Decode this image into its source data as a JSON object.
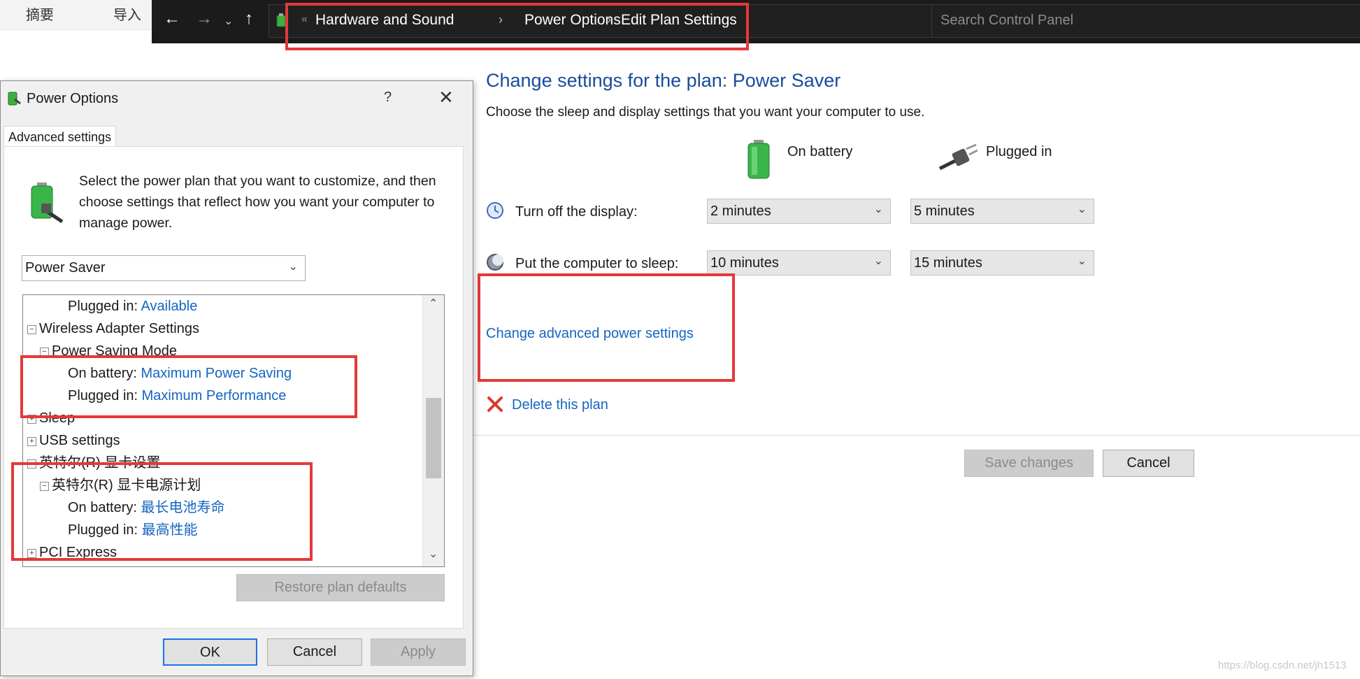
{
  "left_strip": {
    "tab1": "摘要",
    "tab2": "导入"
  },
  "address_bar": {
    "crumbs": [
      "Hardware and Sound",
      "Power Options",
      "Edit Plan Settings"
    ],
    "overflow": "«",
    "search_placeholder": "Search Control Panel"
  },
  "main": {
    "title": "Change settings for the plan: Power Saver",
    "description": "Choose the sleep and display settings that you want your computer to use.",
    "col_battery": "On battery",
    "col_plugged": "Plugged in",
    "rows": [
      {
        "label": "Turn off the display:",
        "battery": "2 minutes",
        "plugged": "5 minutes"
      },
      {
        "label": "Put the computer to sleep:",
        "battery": "10 minutes",
        "plugged": "15 minutes"
      }
    ],
    "advanced_link": "Change advanced power settings",
    "delete_link": "Delete this plan",
    "save_button": "Save changes",
    "cancel_button": "Cancel"
  },
  "dialog": {
    "title": "Power Options",
    "help": "?",
    "tab": "Advanced settings",
    "intro": "Select the power plan that you want to customize, and then choose settings that reflect how you want your computer to manage power.",
    "plan": "Power Saver",
    "tree": {
      "r1_label": "Plugged in:",
      "r1_value": "Available",
      "r2": "Wireless Adapter Settings",
      "r3": "Power Saving Mode",
      "r4_label": "On battery:",
      "r4_value": "Maximum Power Saving",
      "r5_label": "Plugged in:",
      "r5_value": "Maximum Performance",
      "r6": "Sleep",
      "r7": "USB settings",
      "r8": "英特尔(R) 显卡设置",
      "r9": "英特尔(R) 显卡电源计划",
      "r10_label": "On battery:",
      "r10_value": "最长电池寿命",
      "r11_label": "Plugged in:",
      "r11_value": "最高性能",
      "r12": "PCI Express"
    },
    "restore_button": "Restore plan defaults",
    "ok_button": "OK",
    "cancel_button": "Cancel",
    "apply_button": "Apply"
  },
  "watermark": "https://blog.csdn.net/jh1513",
  "colors": {
    "accent_red": "#e5383b",
    "link_blue": "#1565c0",
    "title_blue": "#1a4b9b",
    "addressbar_bg": "#1b1b1b"
  }
}
